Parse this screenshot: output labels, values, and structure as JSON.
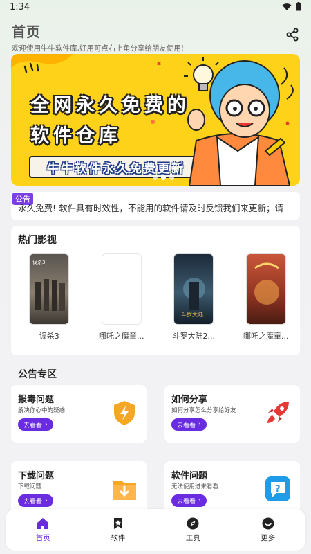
{
  "status": {
    "time": "1:34"
  },
  "header": {
    "title": "首页",
    "subtitle": "欢迎使用牛牛软件库,好用可点右上角分享给朋友使用!"
  },
  "banner": {
    "line1": "全网永久免费的",
    "line2": "软件仓库",
    "ribbon": "牛牛软件永久免费更新",
    "slide_count": 3,
    "active_slide": 2
  },
  "notice": {
    "tag": "公告",
    "text": "永久免费!   软件具有时效性，不能用的软件请及时反馈我们来更新；请"
  },
  "hot": {
    "title": "热门影视",
    "movies": [
      {
        "name": "误杀3",
        "poster_color": "#6b6258"
      },
      {
        "name": "哪吒之魔童...",
        "poster_color": "#ffffff"
      },
      {
        "name": "斗罗大陆2...",
        "poster_color": "#2a3a4d"
      },
      {
        "name": "哪吒之魔童...",
        "poster_color": "#a9432a"
      }
    ]
  },
  "notices_section": {
    "title": "公告专区",
    "cards": [
      {
        "title": "报毒问题",
        "desc": "解决你心中的疑惑",
        "button": "去看看",
        "icon": "shield-bolt-icon"
      },
      {
        "title": "如何分享",
        "desc": "如何分享怎么分享给好友",
        "button": "去看看",
        "icon": "rocket-icon"
      },
      {
        "title": "下载问题",
        "desc": "下载问题",
        "button": "去看看",
        "icon": "download-folder-icon"
      },
      {
        "title": "软件问题",
        "desc": "无法使用进来看看",
        "button": "去看看",
        "icon": "help-chat-icon"
      }
    ]
  },
  "nav": {
    "items": [
      {
        "label": "首页",
        "icon": "home-icon",
        "active": true
      },
      {
        "label": "软件",
        "icon": "bookmark-star-icon",
        "active": false
      },
      {
        "label": "工具",
        "icon": "compass-icon",
        "active": false
      },
      {
        "label": "更多",
        "icon": "smile-icon",
        "active": false
      }
    ]
  },
  "colors": {
    "accent": "#6a2ce0",
    "banner": "#ffd21a",
    "notice_tag": "#7b3fe4"
  }
}
